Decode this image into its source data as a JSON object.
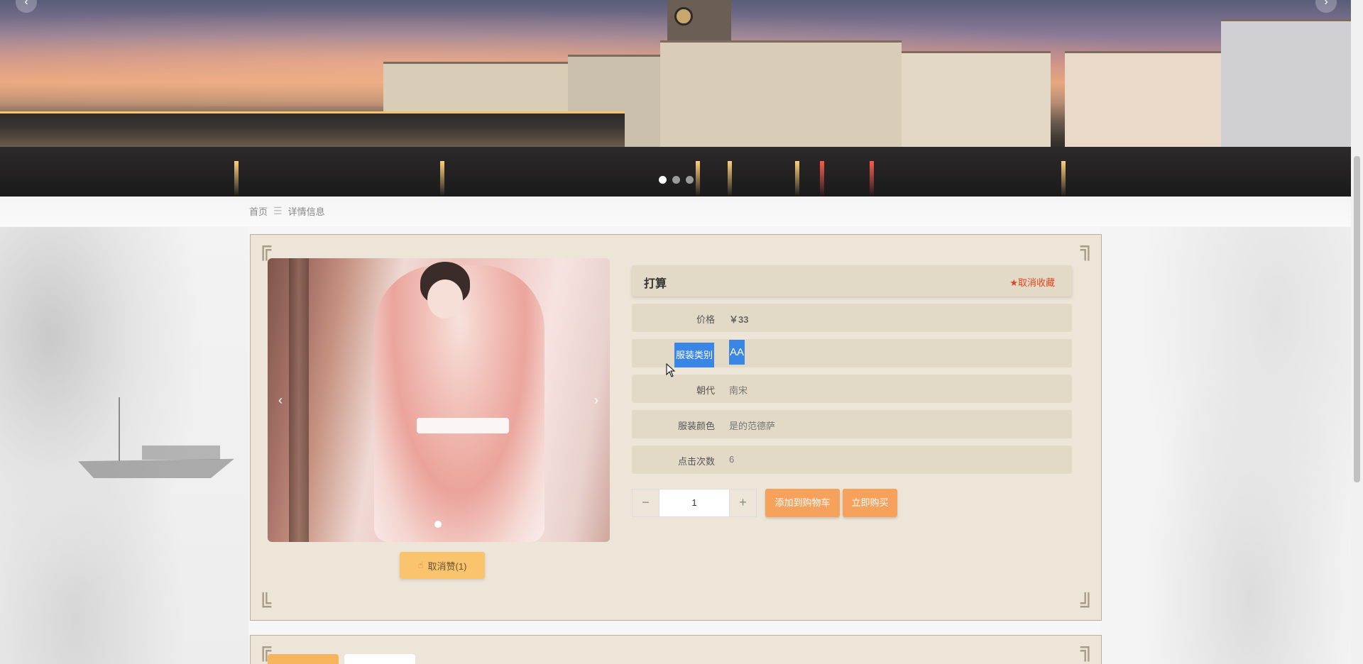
{
  "breadcrumb": {
    "home": "首页",
    "separator": "☰",
    "current": "详情信息"
  },
  "product": {
    "title": "打算",
    "favorite_label": "★取消收藏",
    "fields": [
      {
        "label": "价格",
        "value": "￥33"
      },
      {
        "label": "服装类别",
        "value": "AA"
      },
      {
        "label": "朝代",
        "value": "南宋"
      },
      {
        "label": "服装颜色",
        "value": "是的范德萨"
      },
      {
        "label": "点击次数",
        "value": "6"
      }
    ],
    "quantity": "1",
    "add_to_cart_label": "添加到购物车",
    "buy_now_label": "立即购买",
    "like_label": "取消赞(1)"
  },
  "banner": {
    "dot_count": 3,
    "active_dot": 0
  },
  "icons": {
    "like": "thumbs-up-icon",
    "prev": "chevron-left-icon",
    "next": "chevron-right-icon",
    "minus": "minus-icon",
    "plus": "plus-icon"
  },
  "colors": {
    "panel_bg": "#ece5d8",
    "row_bg": "#e3d9c7",
    "accent": "#f6a25c",
    "favorite": "#e0451f",
    "selection": "#3a86e6"
  }
}
